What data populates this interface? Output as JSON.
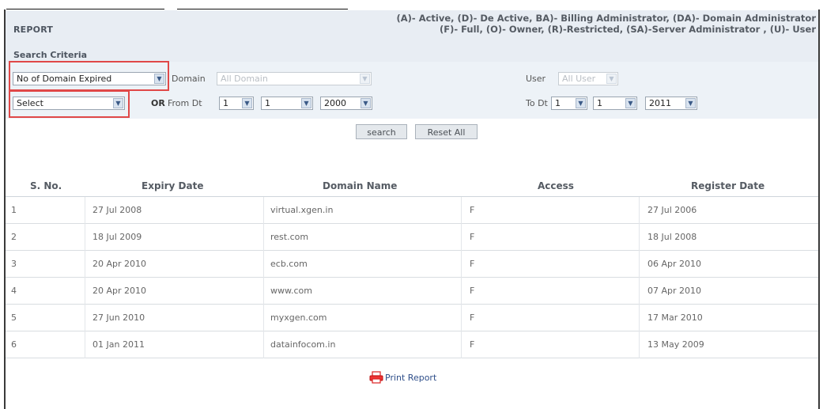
{
  "report": {
    "title": "REPORT",
    "legend_line1": "(A)- Active, (D)- De Active, BA)- Billing Administrator, (DA)- Domain Administrator",
    "legend_line2": "(F)- Full, (O)- Owner, (R)-Restricted, (SA)-Server Administrator , (U)- User"
  },
  "criteria": {
    "title": "Search Criteria",
    "report_type_select": "No of Domain Expired",
    "domain_label": "Domain",
    "domain_select": "All Domain",
    "user_label": "User",
    "user_select": "All User",
    "secondary_select": "Select",
    "or_label": "OR",
    "from_label": "From Dt",
    "from_day": "1",
    "from_month": "1",
    "from_year": "2000",
    "to_label": "To Dt",
    "to_day": "1",
    "to_month": "1",
    "to_year": "2011"
  },
  "actions": {
    "search": "search",
    "reset": "Reset All",
    "print": "Print Report"
  },
  "table": {
    "headers": [
      "S. No.",
      "Expiry Date",
      "Domain Name",
      "Access",
      "Register Date"
    ],
    "rows": [
      [
        "1",
        "27 Jul 2008",
        "virtual.xgen.in",
        "F",
        "27 Jul 2006"
      ],
      [
        "2",
        "18 Jul 2009",
        "rest.com",
        "F",
        "18 Jul 2008"
      ],
      [
        "3",
        "20 Apr 2010",
        "ecb.com",
        "F",
        "06 Apr 2010"
      ],
      [
        "4",
        "20 Apr 2010",
        "www.com",
        "F",
        "07 Apr 2010"
      ],
      [
        "5",
        "27 Jun 2010",
        "myxgen.com",
        "F",
        "17 Mar 2010"
      ],
      [
        "6",
        "01 Jan 2011",
        "datainfocom.in",
        "F",
        "13 May 2009"
      ]
    ]
  },
  "colors": {
    "highlight": "#e04848",
    "header_band": "#e8edf3",
    "link": "#2f4f8a"
  },
  "icons": {
    "print": "printer-icon",
    "dropdown": "chevron-down-icon"
  }
}
